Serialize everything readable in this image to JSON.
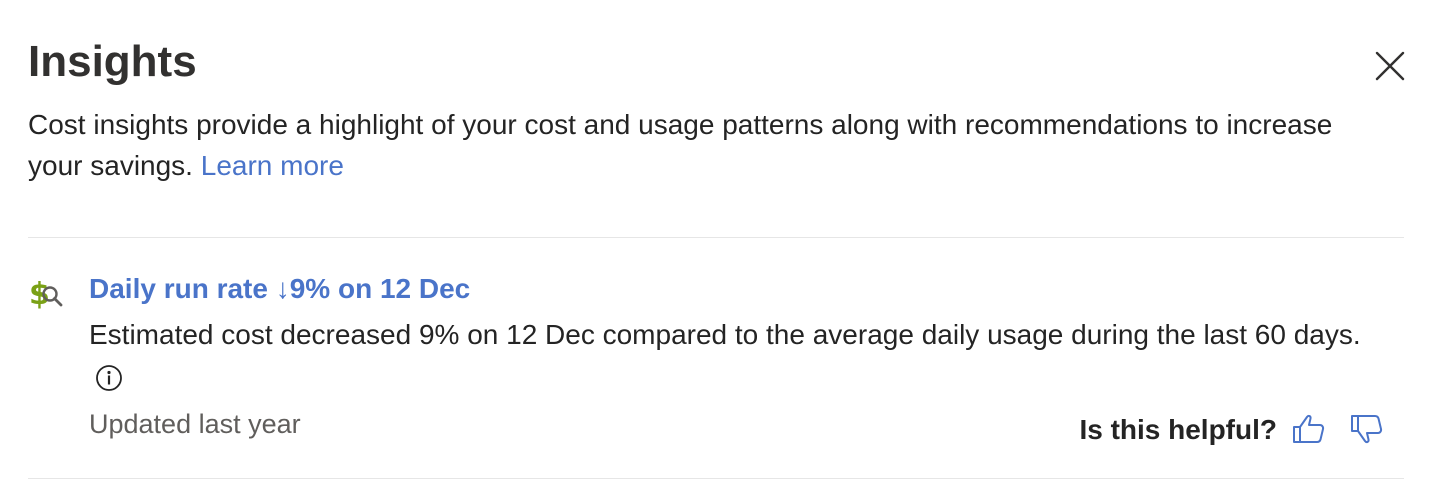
{
  "panel": {
    "title": "Insights",
    "close_icon": "close-icon",
    "description": "Cost insights provide a highlight of your cost and usage patterns along with recommendations to increase your savings.",
    "learn_more": "Learn more"
  },
  "insight": {
    "icon": "cost-search-icon",
    "title": "Daily run rate ↓9% on 12 Dec",
    "body": "Estimated cost decreased 9% on 12 Dec compared to the average daily usage during the last 60 days.",
    "info_icon": "info-icon",
    "updated": "Updated last year"
  },
  "feedback": {
    "label": "Is this helpful?",
    "thumbs_up_icon": "thumbs-up-icon",
    "thumbs_down_icon": "thumbs-down-icon"
  },
  "colors": {
    "link": "#4a74c9",
    "icon_green": "#7aa116",
    "text": "#242424",
    "muted": "#605e5c"
  }
}
